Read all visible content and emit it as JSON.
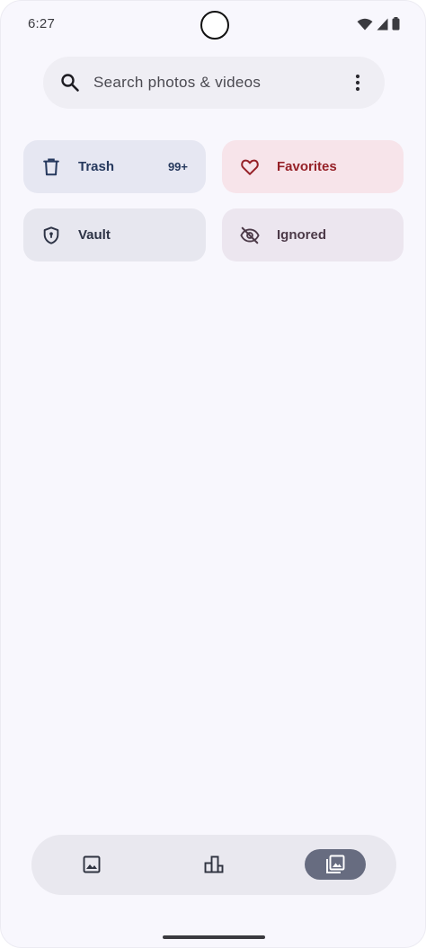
{
  "status_bar": {
    "time": "6:27",
    "icons": [
      "wifi-icon",
      "cellular-signal-icon",
      "battery-icon"
    ]
  },
  "search": {
    "placeholder": "Search photos & videos",
    "search_icon": "search-icon",
    "menu_icon": "more-vertical-icon"
  },
  "tiles": [
    {
      "label": "Trash",
      "badge": "99+",
      "icon": "trash-icon",
      "color": "#26395e",
      "background": "#e6e7f2"
    },
    {
      "label": "Favorites",
      "icon": "heart-icon",
      "color": "#962128",
      "background": "#f7e4ea"
    },
    {
      "label": "Vault",
      "icon": "shield-lock-icon",
      "color": "#2d3345",
      "background": "#e7e7ef"
    },
    {
      "label": "Ignored",
      "icon": "eye-off-icon",
      "color": "#4c3a48",
      "background": "#ece6ef"
    }
  ],
  "bottom_nav": {
    "items": [
      {
        "icon": "image-icon",
        "selected": false
      },
      {
        "icon": "album-stack-icon",
        "selected": false
      },
      {
        "icon": "photo-library-icon",
        "selected": true
      }
    ],
    "selected_color": "#676c80"
  },
  "colors": {
    "background": "#f8f7fd",
    "search_background": "#efeef4",
    "nav_background": "#e9e8ef"
  }
}
